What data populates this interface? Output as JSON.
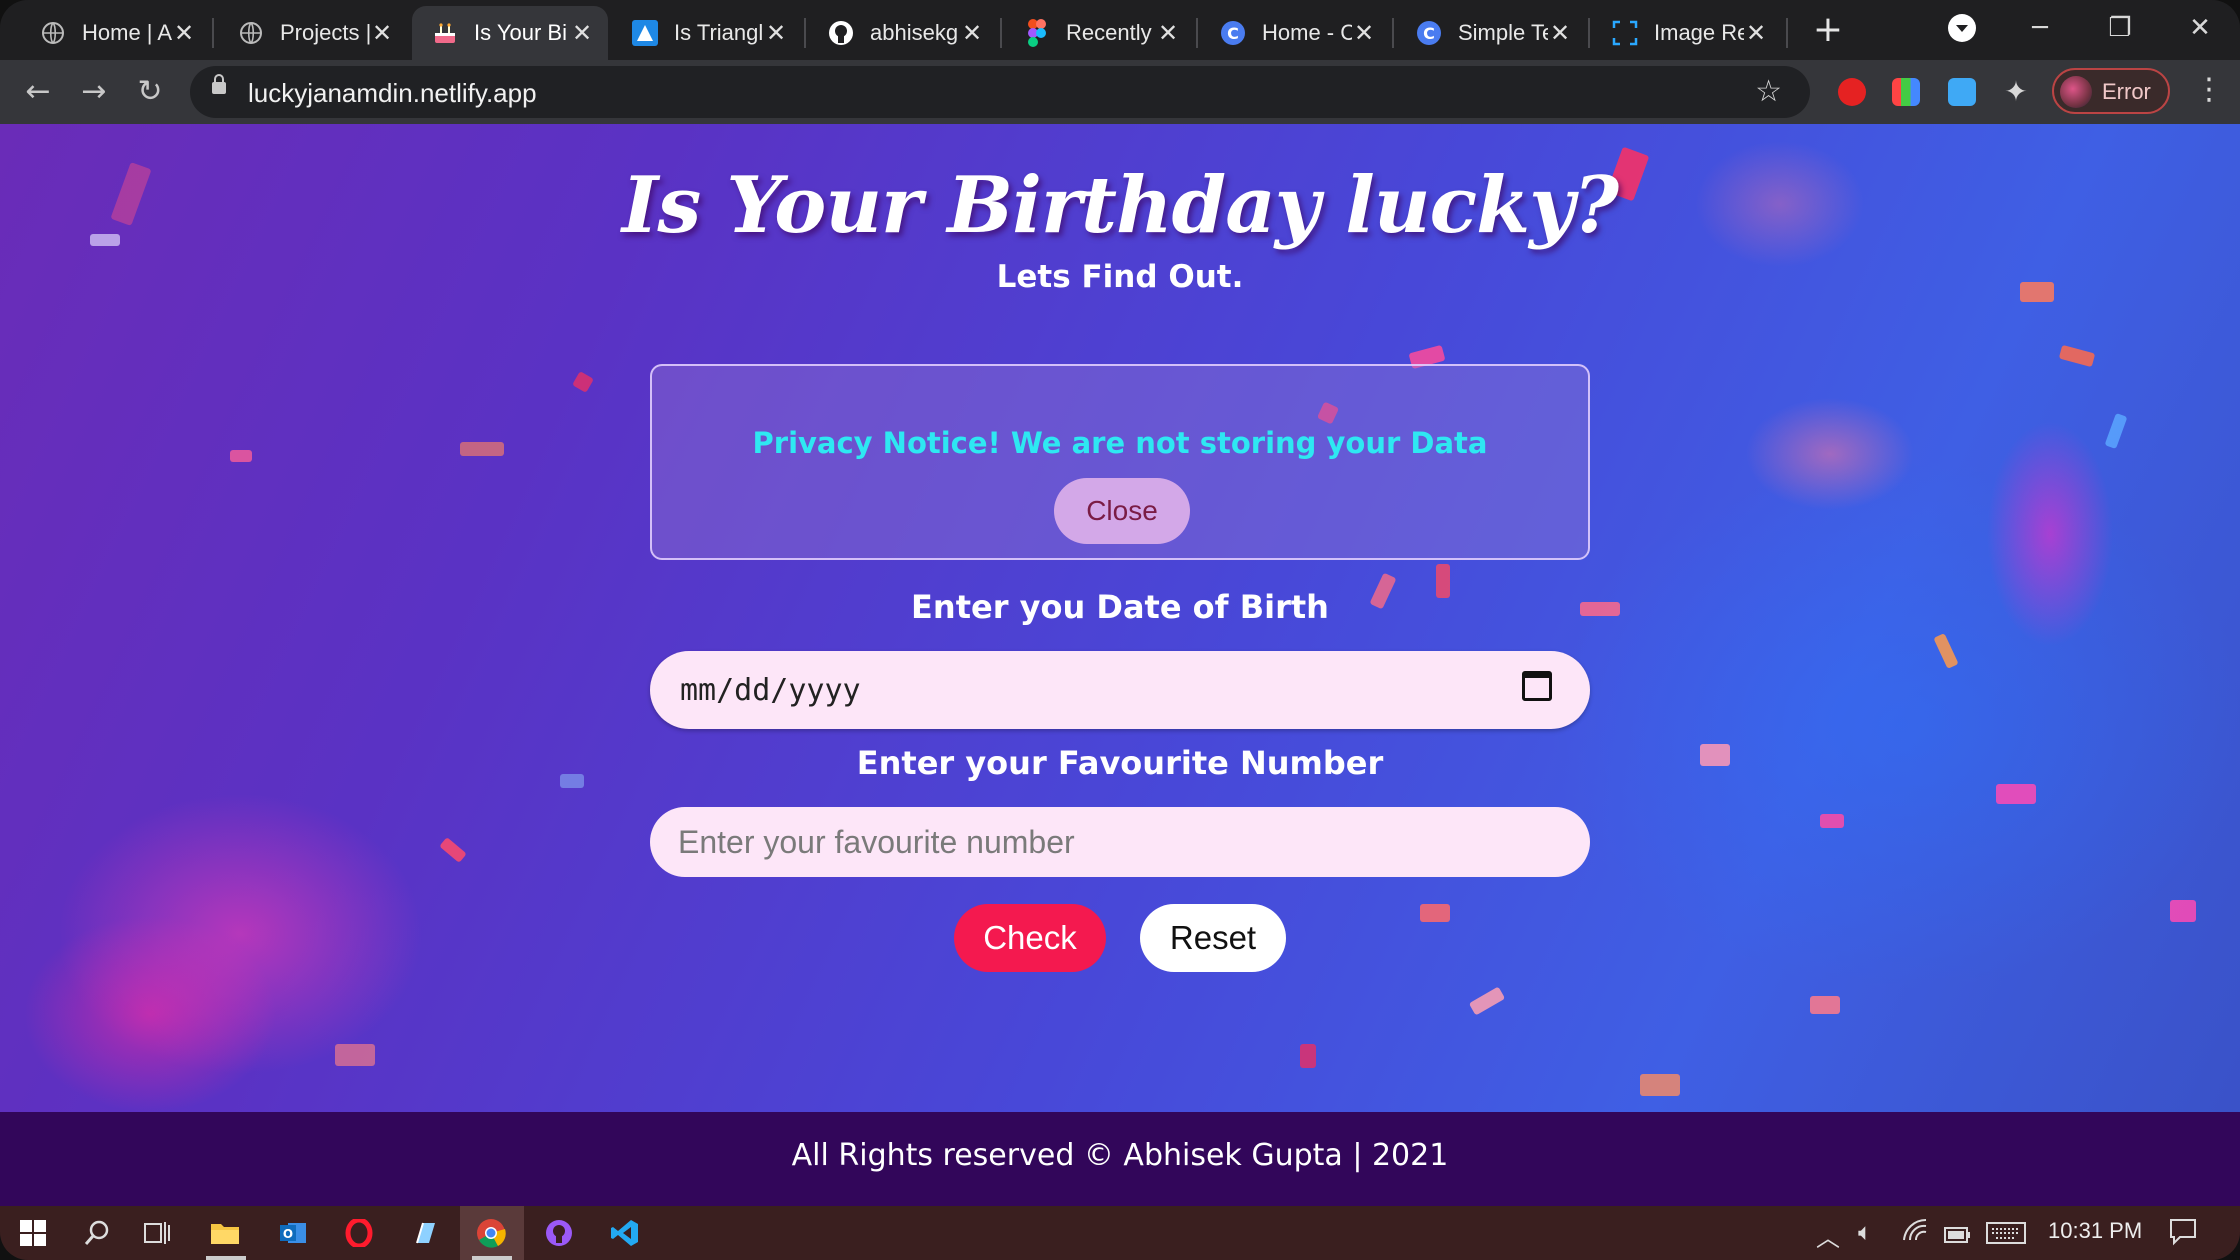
{
  "browser": {
    "tabs": [
      {
        "title": "Home | A",
        "icon": "globe-icon"
      },
      {
        "title": "Projects |",
        "icon": "globe-icon"
      },
      {
        "title": "Is Your Bi",
        "icon": "birthday-cake-icon",
        "active": true
      },
      {
        "title": "Is Triangl",
        "icon": "triangle-icon"
      },
      {
        "title": "abhisekg",
        "icon": "github-icon"
      },
      {
        "title": "Recently",
        "icon": "figma-icon"
      },
      {
        "title": "Home - C",
        "icon": "c-logo-icon"
      },
      {
        "title": "Simple Te",
        "icon": "c-logo-icon"
      },
      {
        "title": "Image Re",
        "icon": "image-frame-icon"
      }
    ],
    "url": "luckyjanamdin.netlify.app",
    "profile_label": "Error",
    "accent_color": "#f4194f"
  },
  "page": {
    "title": "Is Your Birthday lucky?",
    "subtitle": "Lets Find Out.",
    "notice": {
      "text": "Privacy Notice! We are not storing your Data",
      "close_label": "Close"
    },
    "dob": {
      "label": "Enter you Date of Birth",
      "placeholder": "mm/dd/yyyy"
    },
    "favourite": {
      "label": "Enter your Favourite Number",
      "placeholder": "Enter your favourite number"
    },
    "check_label": "Check",
    "reset_label": "Reset",
    "footer": "All Rights reserved © Abhisek Gupta | 2021"
  },
  "taskbar": {
    "clock": "10:31 PM"
  }
}
